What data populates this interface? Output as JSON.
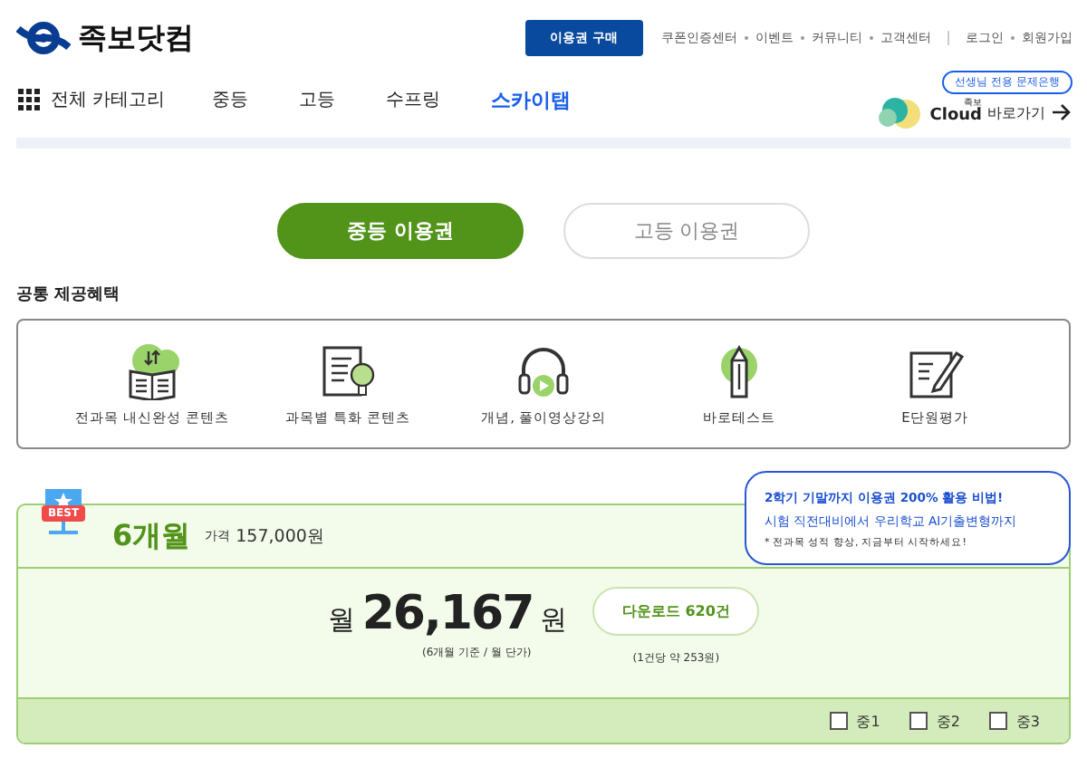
{
  "header": {
    "logo": "족보닷컴",
    "buy_button": "이용권 구매",
    "top_links": [
      "쿠폰인증센터",
      "이벤트",
      "커뮤니티",
      "고객센터"
    ],
    "account_links": [
      "로그인",
      "회원가입"
    ]
  },
  "nav": {
    "menu": "전체 카테고리",
    "items": [
      {
        "label": "중등",
        "kind": "text"
      },
      {
        "label": "고등",
        "kind": "text"
      },
      {
        "label": "수프링",
        "kind": "text"
      },
      {
        "label": "스카이탭",
        "kind": "brand"
      }
    ],
    "cloud": {
      "badge": "선생님 전용 문제은행",
      "small": "족보",
      "name": "Cloud",
      "link": "바로가기"
    }
  },
  "tabs": [
    {
      "label": "중등 이용권",
      "selected": true
    },
    {
      "label": "고등 이용권",
      "selected": false
    }
  ],
  "benefits": {
    "title": "공통 제공혜택",
    "items": [
      {
        "label": "전과목 내신완성 콘텐츠",
        "kind": "book"
      },
      {
        "label": "과목별 특화 콘텐츠",
        "kind": "bulb"
      },
      {
        "label": "개념, 풀이영상강의",
        "kind": "headset"
      },
      {
        "label": "바로테스트",
        "kind": "pencil"
      },
      {
        "label": "E단원평가",
        "kind": "note"
      }
    ]
  },
  "plan": {
    "badge": "BEST",
    "name": "6개월",
    "price_label": "가격",
    "price": "157,000원",
    "month_prefix": "월",
    "amount": "26,167",
    "unit": "원",
    "amount_note": "(6개월 기준 / 월 단가)",
    "download": "다운로드 620건",
    "download_note": "(1건당 약 253원)",
    "grades": [
      {
        "label": "중1",
        "checked": false
      },
      {
        "label": "중2",
        "checked": false
      },
      {
        "label": "중3",
        "checked": false
      }
    ],
    "bubble": {
      "headline": "2학기 기말까지 이용권 200% 활용 비법!",
      "subline": "시험 직전대비에서 우리학교 AI기출변형까지",
      "note": "* 전과목 성적 향상, 지금부터 시작하세요!"
    }
  }
}
